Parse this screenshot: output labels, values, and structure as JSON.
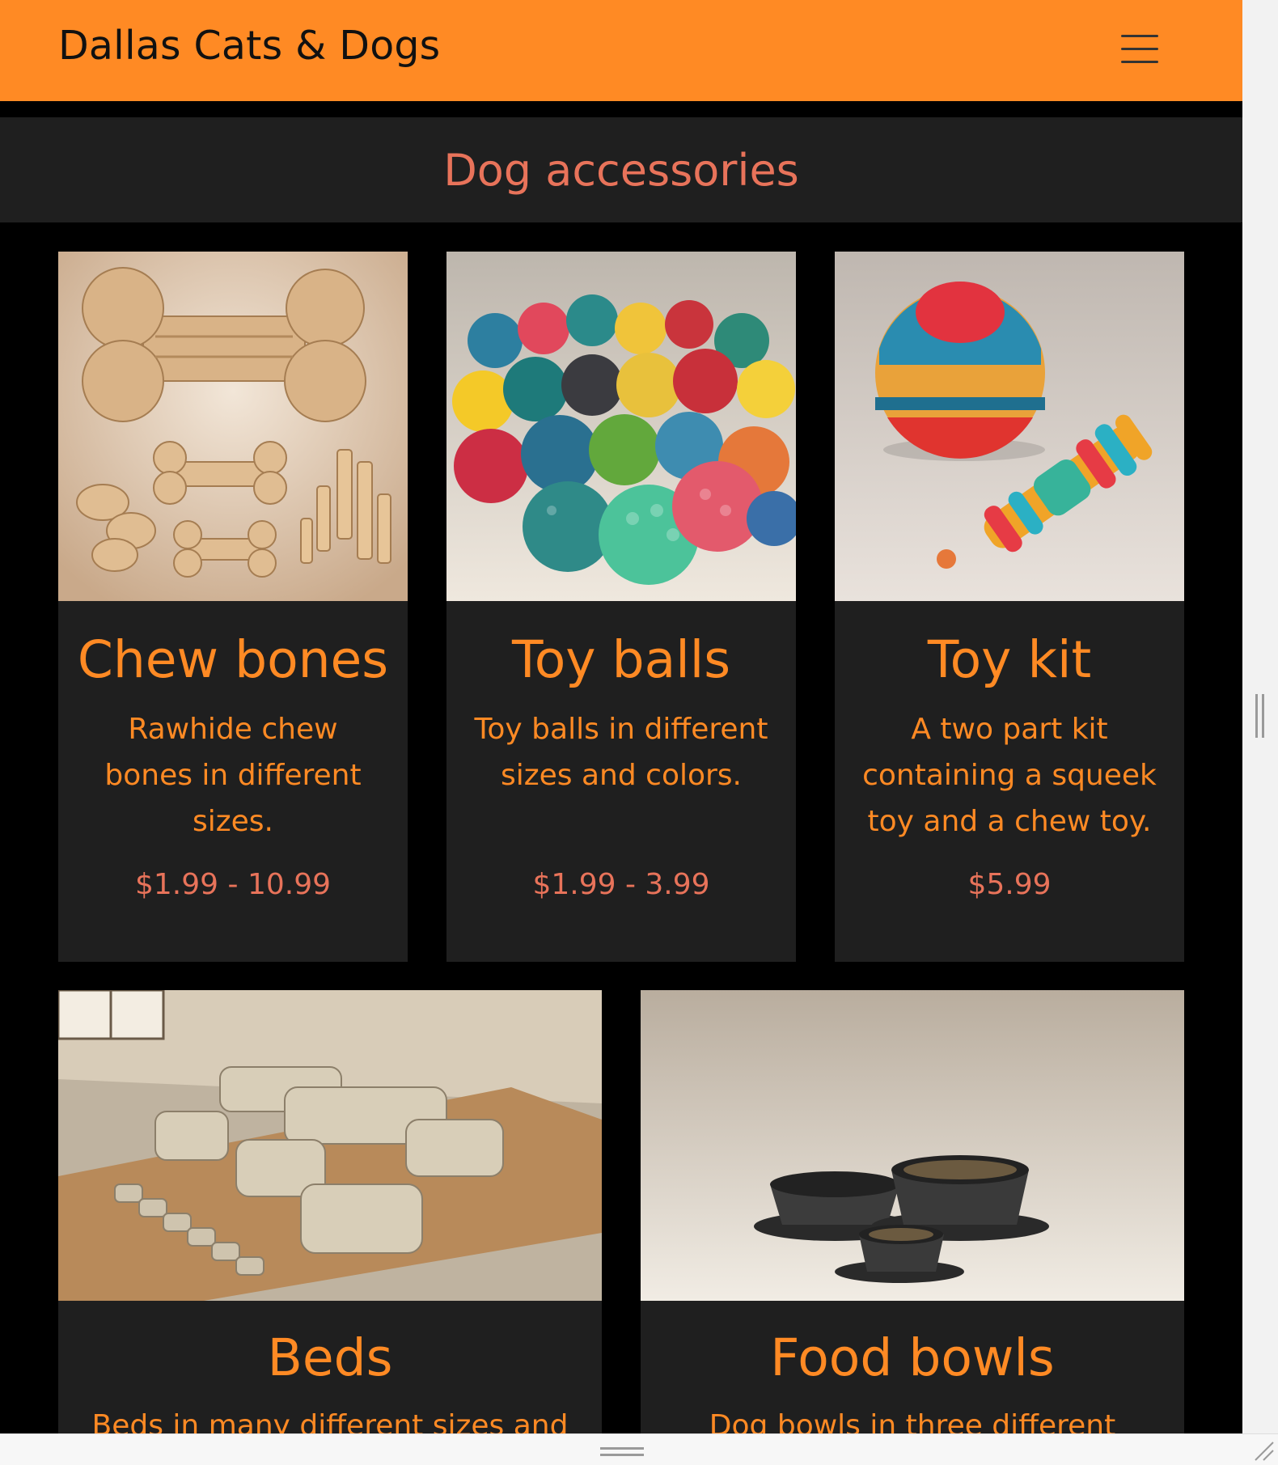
{
  "navbar": {
    "brand": "Dallas Cats & Dogs",
    "menu_icon": "hamburger-menu-icon"
  },
  "section": {
    "title": "Dog accessories"
  },
  "products": [
    {
      "title": "Chew bones",
      "description": "Rawhide chew bones in different sizes.",
      "price": "$1.99 - 10.99",
      "image": "chew-bones-photo"
    },
    {
      "title": "Toy balls",
      "description": "Toy balls in different sizes and colors.",
      "price": "$1.99 - 3.99",
      "image": "toy-balls-photo"
    },
    {
      "title": "Toy kit",
      "description": "A two part kit containing a squeek toy and a chew toy.",
      "price": "$5.99",
      "image": "toy-kit-photo"
    },
    {
      "title": "Beds",
      "description": "Beds in many different sizes and",
      "image": "dog-beds-photo"
    },
    {
      "title": "Food bowls",
      "description": "Dog bowls in three different sizes.",
      "image": "food-bowls-photo"
    }
  ],
  "colors": {
    "navbar": "#ff8a24",
    "accent_text": "#ff8a24",
    "section_title": "#e8735a",
    "price": "#e8735a",
    "card_background": "#1f1f1f",
    "page_background": "#000000"
  }
}
